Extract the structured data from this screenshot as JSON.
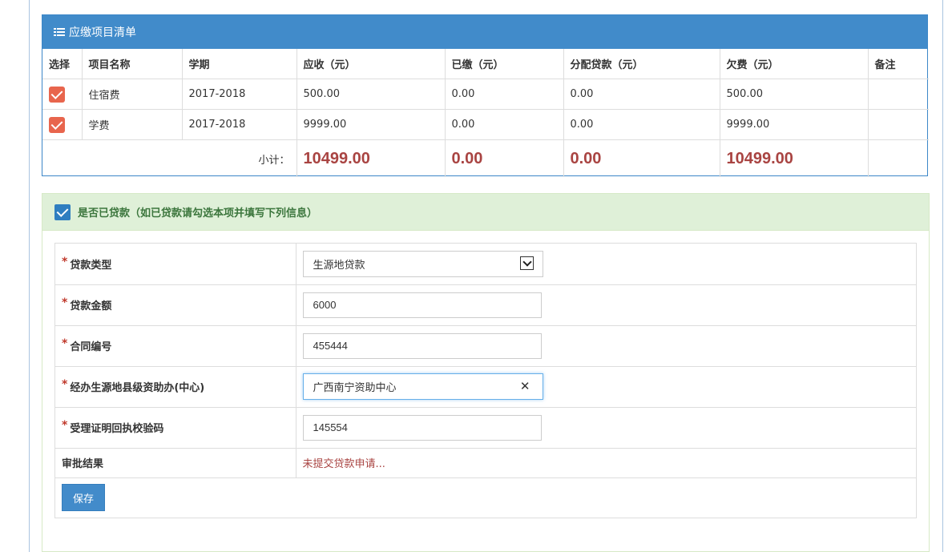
{
  "fee_panel": {
    "title": "应缴项目清单",
    "columns": [
      "选择",
      "项目名称",
      "学期",
      "应收（元）",
      "已缴（元）",
      "分配贷款（元）",
      "欠费（元）",
      "备注"
    ],
    "rows": [
      {
        "checked": true,
        "name": "住宿费",
        "term": "2017-2018",
        "receivable": "500.00",
        "paid": "0.00",
        "loan": "0.00",
        "owed": "500.00",
        "note": ""
      },
      {
        "checked": true,
        "name": "学费",
        "term": "2017-2018",
        "receivable": "9999.00",
        "paid": "0.00",
        "loan": "0.00",
        "owed": "9999.00",
        "note": ""
      }
    ],
    "subtotal": {
      "label": "小计：",
      "receivable": "10499.00",
      "paid": "0.00",
      "loan": "0.00",
      "owed": "10499.00"
    }
  },
  "loan_panel": {
    "checked": true,
    "title": "是否已贷款（如已贷款请勾选本项并填写下列信息）",
    "fields": {
      "loan_type": {
        "label": "贷款类型",
        "value": "生源地贷款"
      },
      "loan_amount": {
        "label": "贷款金额",
        "value": "6000"
      },
      "contract_no": {
        "label": "合同编号",
        "value": "455444"
      },
      "office": {
        "label": "经办生源地县级资助办(中心)",
        "value": "广西南宁资助中心"
      },
      "receipt_code": {
        "label": "受理证明回执校验码",
        "value": "145554"
      }
    },
    "approval": {
      "label": "审批结果",
      "value": "未提交贷款申请..."
    },
    "save_label": "保存"
  },
  "colors": {
    "header_blue": "#418bca",
    "success_green_bg": "#dff0d8",
    "success_green_text": "#3c763d",
    "danger_red": "#a94442",
    "check_red": "#e8654d"
  },
  "icons": {
    "fee_header": "list-icon",
    "row_select": "checkbox-checked-icon",
    "loan_toggle": "checkbox-checked-icon",
    "select_arrow": "chevron-down-icon",
    "clear": "close-icon"
  }
}
